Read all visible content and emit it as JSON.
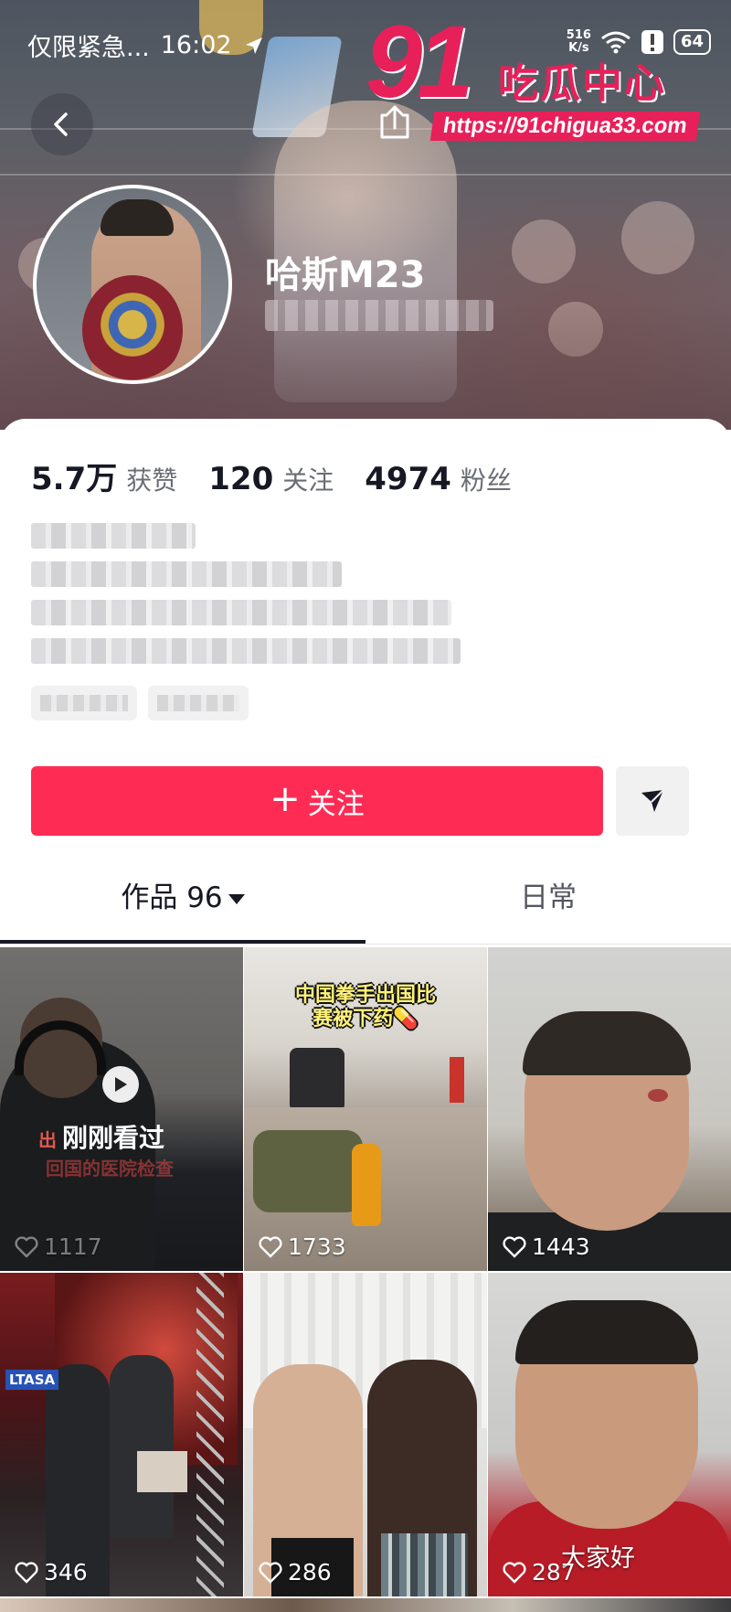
{
  "status_bar": {
    "notification_text": "仅限紧急...",
    "time": "16:02",
    "net_speed_value": "516",
    "net_speed_unit": "K/s",
    "battery": "64"
  },
  "watermark": {
    "number": "91",
    "name": "吃瓜中心",
    "url": "https://91chigua33.com"
  },
  "profile": {
    "username": "哈斯M23",
    "stats": [
      {
        "value": "5.7万",
        "label": "获赞"
      },
      {
        "value": "120",
        "label": "关注"
      },
      {
        "value": "4974",
        "label": "粉丝"
      }
    ]
  },
  "actions": {
    "follow_plus": "+",
    "follow_label": "关注"
  },
  "tabs": {
    "works_label": "作品 96",
    "daily_label": "日常"
  },
  "videos": [
    {
      "likes": "1117",
      "badge": "刚刚看过",
      "caption_partial": "出",
      "subcaption": "回国的医院检查"
    },
    {
      "likes": "1733",
      "caption": "中国拳手出国比赛被下药💊"
    },
    {
      "likes": "1443"
    },
    {
      "likes": "346",
      "logo_text": "LTASA"
    },
    {
      "likes": "286"
    },
    {
      "likes": "287",
      "caption": "大家好"
    }
  ],
  "colors": {
    "accent": "#fe2c55",
    "watermark": "#e7205a"
  }
}
